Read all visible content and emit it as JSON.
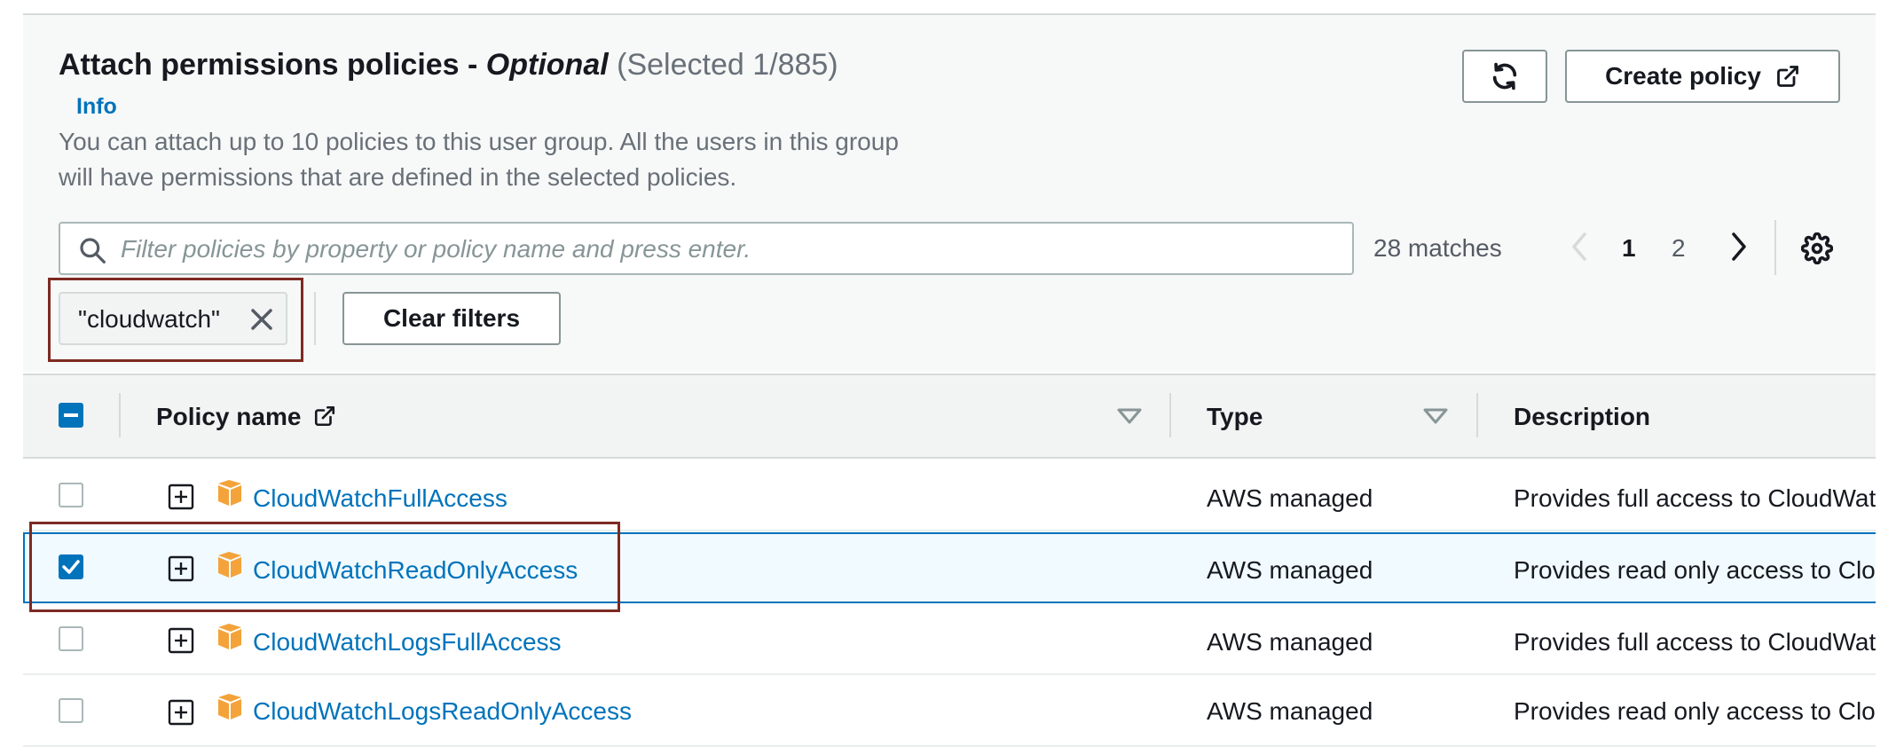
{
  "header": {
    "title": "Attach permissions policies - ",
    "title_optional": "Optional",
    "title_count": "(Selected 1/885)",
    "info_label": "Info",
    "description_line1": "You can attach up to 10 policies to this user group. All the users in this group",
    "description_line2": "will have permissions that are defined in the selected policies."
  },
  "toolbar": {
    "refresh_icon": "refresh-icon",
    "create_policy_label": "Create policy",
    "external_icon": "external-link-icon"
  },
  "search": {
    "placeholder": "Filter policies by property or policy name and press enter.",
    "value": "",
    "matches_label": "28 matches"
  },
  "pagination": {
    "pages": [
      "1",
      "2"
    ],
    "current": "1"
  },
  "filter": {
    "token_label": "\"cloudwatch\"",
    "clear_label": "Clear filters"
  },
  "table": {
    "columns": {
      "policy_name": "Policy name",
      "type": "Type",
      "description": "Description"
    },
    "rows": [
      {
        "name": "CloudWatchFullAccess",
        "type": "AWS managed",
        "description": "Provides full access to CloudWatch.",
        "selected": false
      },
      {
        "name": "CloudWatchReadOnlyAccess",
        "type": "AWS managed",
        "description": "Provides read only access to CloudWatch.",
        "selected": true
      },
      {
        "name": "CloudWatchLogsFullAccess",
        "type": "AWS managed",
        "description": "Provides full access to CloudWatch Logs",
        "selected": false
      },
      {
        "name": "CloudWatchLogsReadOnlyAccess",
        "type": "AWS managed",
        "description": "Provides read only access to CloudWatch Logs",
        "selected": false
      }
    ]
  },
  "colors": {
    "link": "#0073bb",
    "highlight_box": "#7d2a22",
    "selected_row_bg": "#f1faff",
    "policy_icon": "#f3a33a"
  }
}
